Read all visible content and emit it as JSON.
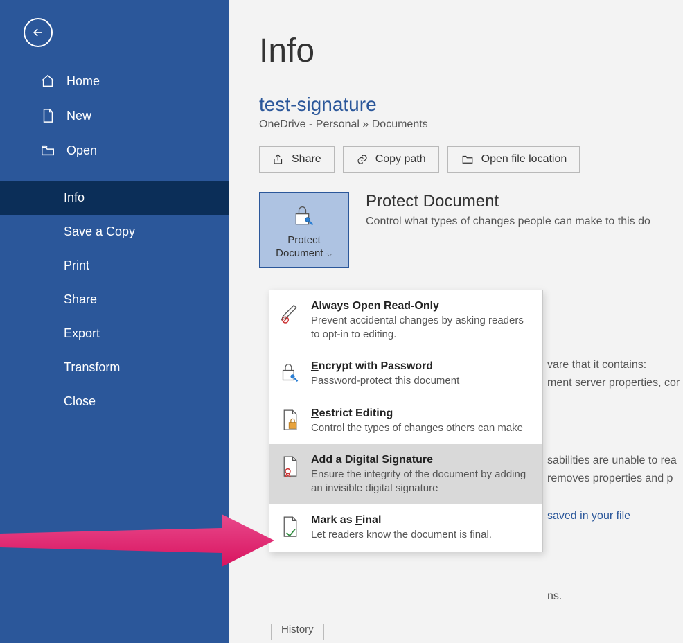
{
  "sidebar": {
    "items": [
      {
        "label": "Home"
      },
      {
        "label": "New"
      },
      {
        "label": "Open"
      },
      {
        "label": "Info"
      },
      {
        "label": "Save a Copy"
      },
      {
        "label": "Print"
      },
      {
        "label": "Share"
      },
      {
        "label": "Export"
      },
      {
        "label": "Transform"
      },
      {
        "label": "Close"
      }
    ]
  },
  "header": {
    "page_title": "Info",
    "doc_title": "test-signature",
    "breadcrumb": "OneDrive - Personal » Documents"
  },
  "actions": {
    "share": "Share",
    "copy_path": "Copy path",
    "open_location": "Open file location"
  },
  "protect": {
    "button_line1": "Protect",
    "button_line2": "Document",
    "heading": "Protect Document",
    "desc": "Control what types of changes people can make to this do"
  },
  "menu": {
    "items": [
      {
        "title_pre": "Always ",
        "title_u": "O",
        "title_post": "pen Read-Only",
        "desc": "Prevent accidental changes by asking readers to opt-in to editing."
      },
      {
        "title_pre": "",
        "title_u": "E",
        "title_post": "ncrypt with Password",
        "desc": "Password-protect this document"
      },
      {
        "title_pre": "",
        "title_u": "R",
        "title_post": "estrict Editing",
        "desc": "Control the types of changes others can make"
      },
      {
        "title_pre": "Add a ",
        "title_u": "D",
        "title_post": "igital Signature",
        "desc": "Ensure the integrity of the document by adding an invisible digital signature"
      },
      {
        "title_pre": "Mark as ",
        "title_u": "F",
        "title_post": "inal",
        "desc": "Let readers know the document is final."
      }
    ]
  },
  "bg": {
    "t1": "vare that it contains:",
    "t2": "ment server properties, cor",
    "t3": "sabilities are unable to rea",
    "t4": "removes properties and p",
    "link": " saved in your file",
    "t5": "ns.",
    "history": "History"
  }
}
